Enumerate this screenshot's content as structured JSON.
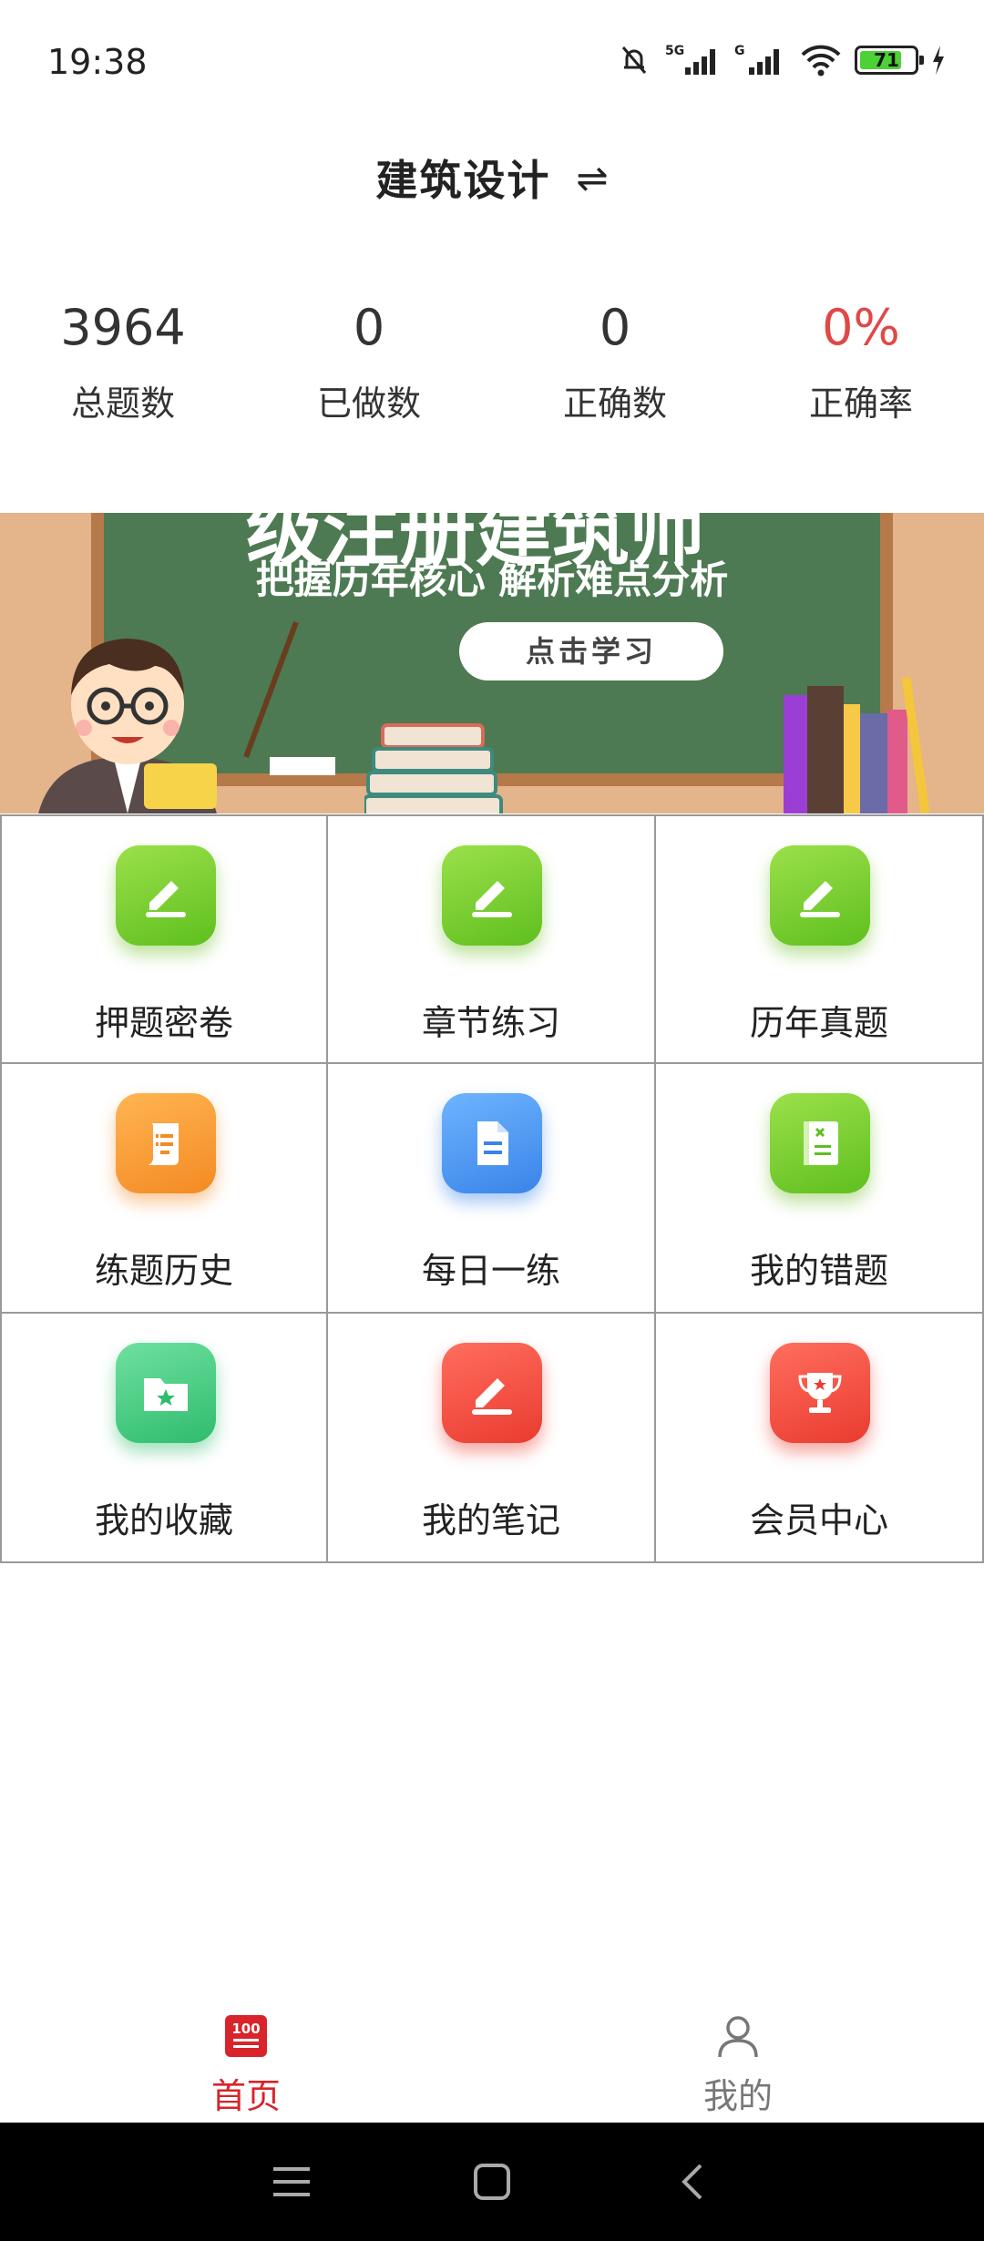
{
  "status_bar": {
    "time": "19:38",
    "network_1": "5G",
    "network_2": "G",
    "battery_level": "71"
  },
  "header": {
    "title": "建筑设计",
    "switch_icon": "⇌"
  },
  "stats": [
    {
      "value": "3964",
      "label": "总题数"
    },
    {
      "value": "0",
      "label": "已做数"
    },
    {
      "value": "0",
      "label": "正确数"
    },
    {
      "value": "0%",
      "label": "正确率",
      "color": "#e04848"
    }
  ],
  "banner": {
    "title_partial": "级注册建筑师",
    "subtitle": "把握历年核心 解析难点分析",
    "button": "点击学习"
  },
  "grid": [
    {
      "label": "押题密卷",
      "icon": "pencil-icon",
      "color": "green"
    },
    {
      "label": "章节练习",
      "icon": "pencil-icon",
      "color": "green"
    },
    {
      "label": "历年真题",
      "icon": "pencil-icon",
      "color": "green"
    },
    {
      "label": "练题历史",
      "icon": "scroll-icon",
      "color": "orange"
    },
    {
      "label": "每日一练",
      "icon": "document-icon",
      "color": "blue"
    },
    {
      "label": "我的错题",
      "icon": "error-book-icon",
      "color": "green"
    },
    {
      "label": "我的收藏",
      "icon": "star-folder-icon",
      "color": "mint"
    },
    {
      "label": "我的笔记",
      "icon": "note-pencil-icon",
      "color": "red"
    },
    {
      "label": "会员中心",
      "icon": "trophy-icon",
      "color": "red"
    }
  ],
  "tabbar": {
    "home_icon_text": "100",
    "home_label": "首页",
    "mine_label": "我的"
  }
}
